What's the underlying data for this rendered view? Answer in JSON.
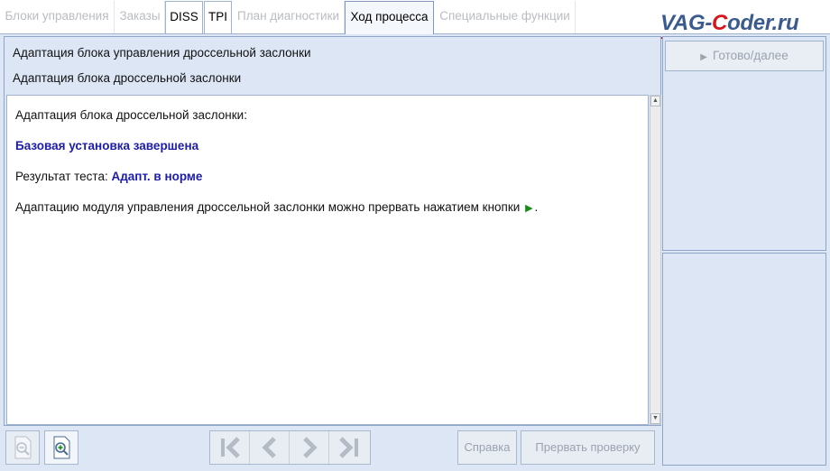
{
  "tabs": [
    {
      "label": "Блоки управления",
      "state": "disabled"
    },
    {
      "label": "Заказы",
      "state": "disabled"
    },
    {
      "label": "DISS",
      "state": "enabled"
    },
    {
      "label": "TPI",
      "state": "enabled"
    },
    {
      "label": "План диагностики",
      "state": "disabled"
    },
    {
      "label": "Ход процесса",
      "state": "active"
    },
    {
      "label": "Специальные функции",
      "state": "disabled"
    }
  ],
  "watermark": {
    "prefix": "VAG-",
    "highlight": "C",
    "suffix": "oder.ru"
  },
  "header": {
    "line1": "Адаптация блока управления дроссельной заслонки",
    "line2": "Адаптация блока дроссельной заслонки"
  },
  "content": {
    "intro": "Адаптация блока дроссельной заслонки:",
    "status": "Базовая установка завершена",
    "result_label": "Результат теста: ",
    "result_value": "Адапт. в норме",
    "abort_hint": "Адаптацию модуля управления дроссельной заслонки можно прервать нажатием кнопки",
    "abort_hint_end": "."
  },
  "right_panel": {
    "ready_button": "Готово/далее"
  },
  "toolbar": {
    "help_label": "Справка",
    "abort_label": "Прервать проверку"
  },
  "icons": {
    "play": "play-icon",
    "first": "skip-first-icon",
    "prev": "chevron-left-icon",
    "next": "chevron-right-icon",
    "last": "skip-last-icon",
    "zoom_out": "zoom-out-icon",
    "zoom_in": "zoom-in-icon"
  },
  "colors": {
    "panel_bg": "#dce6f4",
    "status_text": "#1c1ca8",
    "play_arrow": "#1b8c1b",
    "watermark_red": "#d6151c",
    "watermark_blue": "#3b5a8f"
  }
}
